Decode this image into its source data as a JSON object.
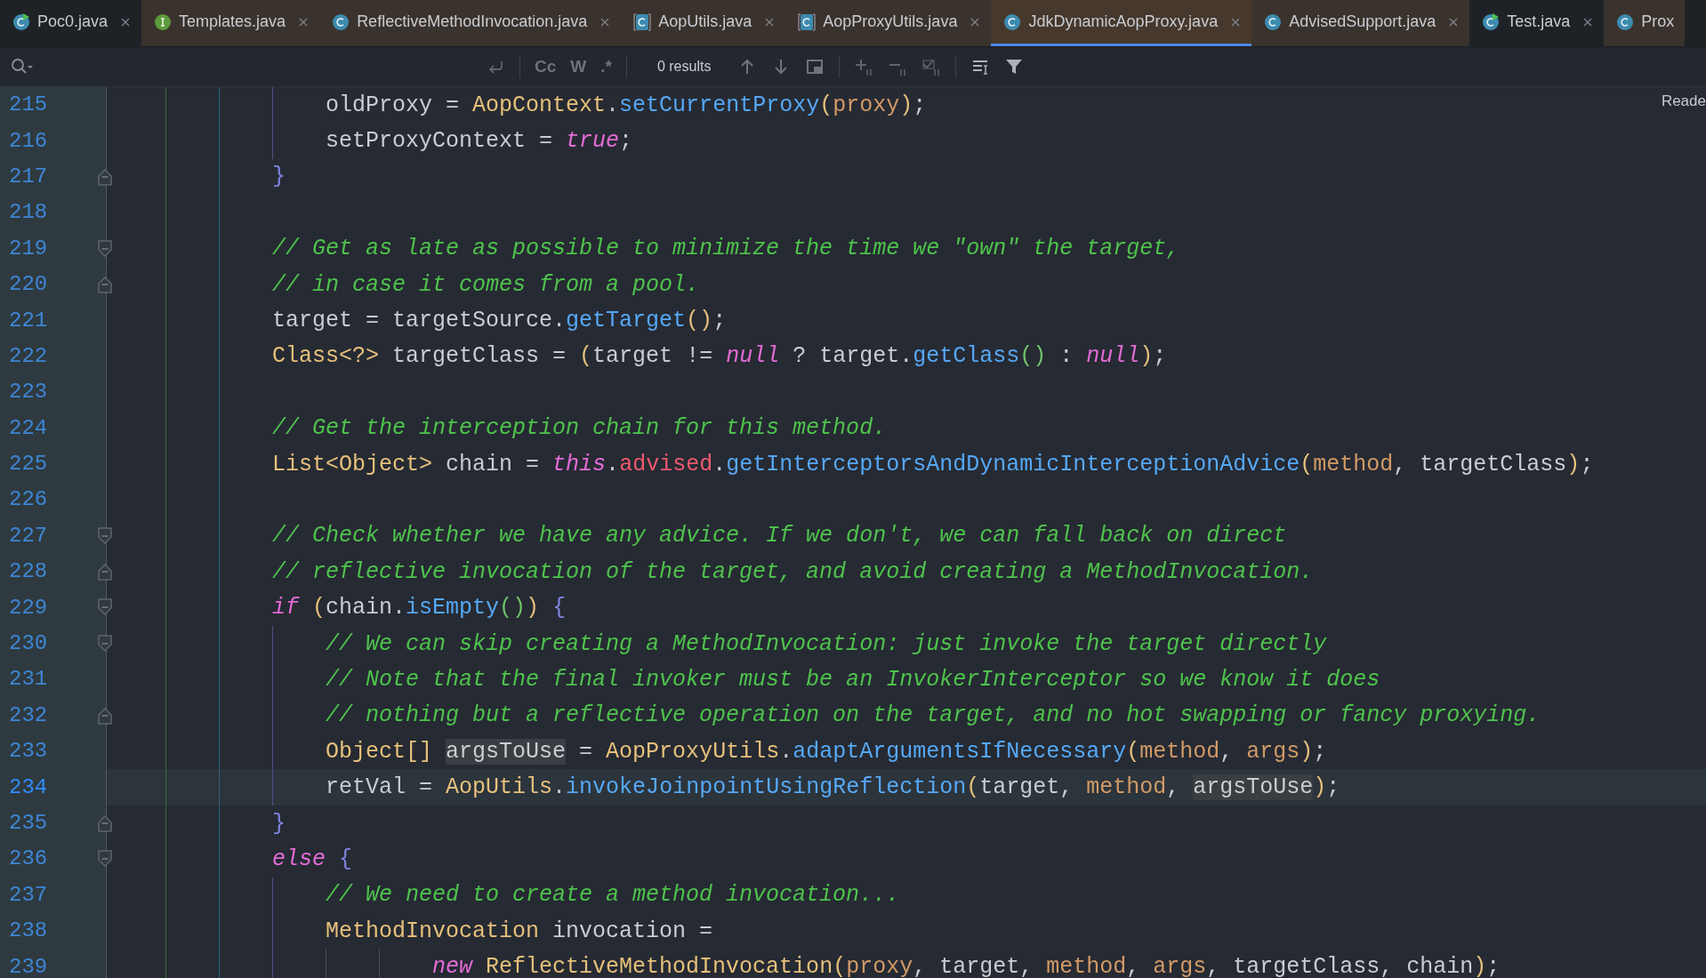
{
  "tabs": [
    {
      "label": "Poc0.java",
      "kind": "runnable",
      "library": false,
      "selected": false,
      "closable": true
    },
    {
      "label": "Templates.java",
      "kind": "interface",
      "library": true,
      "selected": false,
      "closable": true
    },
    {
      "label": "ReflectiveMethodInvocation.java",
      "kind": "class",
      "library": true,
      "selected": false,
      "closable": true
    },
    {
      "label": "AopUtils.java",
      "kind": "readonly",
      "library": true,
      "selected": false,
      "closable": true
    },
    {
      "label": "AopProxyUtils.java",
      "kind": "readonly",
      "library": true,
      "selected": false,
      "closable": true
    },
    {
      "label": "JdkDynamicAopProxy.java",
      "kind": "class",
      "library": true,
      "selected": true,
      "closable": true
    },
    {
      "label": "AdvisedSupport.java",
      "kind": "class",
      "library": true,
      "selected": false,
      "closable": true
    },
    {
      "label": "Test.java",
      "kind": "runnable",
      "library": false,
      "selected": false,
      "closable": true
    },
    {
      "label": "Prox",
      "kind": "class",
      "library": true,
      "selected": false,
      "closable": false
    }
  ],
  "find_bar": {
    "options": [
      {
        "label": "Cc"
      },
      {
        "label": "W"
      },
      {
        "label": ".*"
      }
    ],
    "results": "0 results"
  },
  "reader_mode": "Reade",
  "lines": [
    {
      "number": "215",
      "fold_start": false,
      "fold_end": false,
      "current": false,
      "tokens": [
        {
          "kind": "plain",
          "text": "            oldProxy = "
        },
        {
          "kind": "class",
          "text": "AopContext"
        },
        {
          "kind": "plain",
          "text": "."
        },
        {
          "kind": "method",
          "text": "setCurrentProxy"
        },
        {
          "kind": "paren",
          "text": "("
        },
        {
          "kind": "param",
          "text": "proxy"
        },
        {
          "kind": "paren",
          "text": ")"
        },
        {
          "kind": "plain",
          "text": ";"
        }
      ]
    },
    {
      "number": "216",
      "fold_start": false,
      "fold_end": false,
      "current": false,
      "tokens": [
        {
          "kind": "plain",
          "text": "            setProxyContext = "
        },
        {
          "kind": "keyword",
          "text": "true"
        },
        {
          "kind": "plain",
          "text": ";"
        }
      ]
    },
    {
      "number": "217",
      "fold_start": false,
      "fold_end": true,
      "current": false,
      "tokens": [
        {
          "kind": "brace",
          "text": "        }"
        }
      ]
    },
    {
      "number": "218",
      "fold_start": false,
      "fold_end": false,
      "current": false
    },
    {
      "number": "219",
      "fold_start": true,
      "fold_end": false,
      "current": false,
      "tokens": [
        {
          "kind": "comment",
          "text": "        // Get as late as possible to minimize the time we \"own\" the target,"
        }
      ]
    },
    {
      "number": "220",
      "fold_start": false,
      "fold_end": true,
      "current": false,
      "tokens": [
        {
          "kind": "comment",
          "text": "        // in case it comes from a pool."
        }
      ]
    },
    {
      "number": "221",
      "fold_start": false,
      "fold_end": false,
      "current": false,
      "tokens": [
        {
          "kind": "plain",
          "text": "        target = targetSource."
        },
        {
          "kind": "method",
          "text": "getTarget"
        },
        {
          "kind": "paren",
          "text": "()"
        },
        {
          "kind": "plain",
          "text": ";"
        }
      ]
    },
    {
      "number": "222",
      "fold_start": false,
      "fold_end": false,
      "current": false,
      "tokens": [
        {
          "kind": "class",
          "text": "        Class<?>"
        },
        {
          "kind": "plain",
          "text": " targetClass = "
        },
        {
          "kind": "paren",
          "text": "("
        },
        {
          "kind": "plain",
          "text": "target != "
        },
        {
          "kind": "keyword",
          "text": "null"
        },
        {
          "kind": "plain",
          "text": " ? target."
        },
        {
          "kind": "method",
          "text": "getClass"
        },
        {
          "kind": "paren2",
          "text": "()"
        },
        {
          "kind": "plain",
          "text": " : "
        },
        {
          "kind": "keyword",
          "text": "null"
        },
        {
          "kind": "paren",
          "text": ")"
        },
        {
          "kind": "plain",
          "text": ";"
        }
      ]
    },
    {
      "number": "223",
      "fold_start": false,
      "fold_end": false,
      "current": false
    },
    {
      "number": "224",
      "fold_start": false,
      "fold_end": false,
      "current": false,
      "tokens": [
        {
          "kind": "comment",
          "text": "        // Get the interception chain for this method."
        }
      ]
    },
    {
      "number": "225",
      "fold_start": false,
      "fold_end": false,
      "current": false,
      "tokens": [
        {
          "kind": "class",
          "text": "        List<Object>"
        },
        {
          "kind": "plain",
          "text": " chain = "
        },
        {
          "kind": "keyword",
          "text": "this"
        },
        {
          "kind": "plain",
          "text": "."
        },
        {
          "kind": "field",
          "text": "advised"
        },
        {
          "kind": "plain",
          "text": "."
        },
        {
          "kind": "method",
          "text": "getInterceptorsAndDynamicInterceptionAdvice"
        },
        {
          "kind": "paren",
          "text": "("
        },
        {
          "kind": "param",
          "text": "method"
        },
        {
          "kind": "plain",
          "text": ", targetClass"
        },
        {
          "kind": "paren",
          "text": ")"
        },
        {
          "kind": "plain",
          "text": ";"
        }
      ]
    },
    {
      "number": "226",
      "fold_start": false,
      "fold_end": false,
      "current": false
    },
    {
      "number": "227",
      "fold_start": true,
      "fold_end": false,
      "current": false,
      "tokens": [
        {
          "kind": "comment",
          "text": "        // Check whether we have any advice. If we don't, we can fall back on direct"
        }
      ]
    },
    {
      "number": "228",
      "fold_start": false,
      "fold_end": true,
      "current": false,
      "tokens": [
        {
          "kind": "comment",
          "text": "        // reflective invocation of the target, and avoid creating a MethodInvocation."
        }
      ]
    },
    {
      "number": "229",
      "fold_start": true,
      "fold_end": false,
      "current": false,
      "tokens": [
        {
          "kind": "keyword",
          "text": "        if"
        },
        {
          "kind": "paren",
          "text": " ("
        },
        {
          "kind": "plain",
          "text": "chain."
        },
        {
          "kind": "method",
          "text": "isEmpty"
        },
        {
          "kind": "paren2",
          "text": "()"
        },
        {
          "kind": "paren",
          "text": ")"
        },
        {
          "kind": "brace",
          "text": " {"
        }
      ]
    },
    {
      "number": "230",
      "fold_start": true,
      "fold_end": false,
      "current": false,
      "tokens": [
        {
          "kind": "comment",
          "text": "            // We can skip creating a MethodInvocation: just invoke the target directly"
        }
      ]
    },
    {
      "number": "231",
      "fold_start": false,
      "fold_end": false,
      "current": false,
      "tokens": [
        {
          "kind": "comment",
          "text": "            // Note that the final invoker must be an InvokerInterceptor so we know it does"
        }
      ]
    },
    {
      "number": "232",
      "fold_start": false,
      "fold_end": true,
      "current": false,
      "tokens": [
        {
          "kind": "comment",
          "text": "            // nothing but a reflective operation on the target, and no hot swapping or fancy proxying."
        }
      ]
    },
    {
      "number": "233",
      "fold_start": false,
      "fold_end": false,
      "current": false,
      "tokens": [
        {
          "kind": "class",
          "text": "            Object"
        },
        {
          "kind": "paren",
          "text": "[] "
        },
        {
          "kind": "usage",
          "text": "argsToUse"
        },
        {
          "kind": "plain",
          "text": " = "
        },
        {
          "kind": "class",
          "text": "AopProxyUtils"
        },
        {
          "kind": "plain",
          "text": "."
        },
        {
          "kind": "method",
          "text": "adaptArgumentsIfNecessary"
        },
        {
          "kind": "paren",
          "text": "("
        },
        {
          "kind": "param",
          "text": "method"
        },
        {
          "kind": "plain",
          "text": ", "
        },
        {
          "kind": "param",
          "text": "args"
        },
        {
          "kind": "paren",
          "text": ")"
        },
        {
          "kind": "plain",
          "text": ";"
        }
      ]
    },
    {
      "number": "234",
      "fold_start": false,
      "fold_end": false,
      "current": true,
      "tokens": [
        {
          "kind": "plain",
          "text": "            retVal = "
        },
        {
          "kind": "class",
          "text": "AopUtils"
        },
        {
          "kind": "plain",
          "text": "."
        },
        {
          "kind": "method",
          "text": "invokeJoinpointUsingReflection"
        },
        {
          "kind": "paren",
          "text": "("
        },
        {
          "kind": "plain",
          "text": "target, "
        },
        {
          "kind": "param",
          "text": "method"
        },
        {
          "kind": "plain",
          "text": ", "
        },
        {
          "kind": "usage",
          "text": "argsToUse"
        },
        {
          "kind": "paren",
          "text": ")"
        },
        {
          "kind": "plain",
          "text": ";"
        }
      ]
    },
    {
      "number": "235",
      "fold_start": false,
      "fold_end": true,
      "current": false,
      "tokens": [
        {
          "kind": "brace",
          "text": "        }"
        }
      ]
    },
    {
      "number": "236",
      "fold_start": true,
      "fold_end": false,
      "current": false,
      "tokens": [
        {
          "kind": "keyword",
          "text": "        else"
        },
        {
          "kind": "brace",
          "text": " {"
        }
      ]
    },
    {
      "number": "237",
      "fold_start": false,
      "fold_end": false,
      "current": false,
      "tokens": [
        {
          "kind": "comment",
          "text": "            // We need to create a method invocation..."
        }
      ]
    },
    {
      "number": "238",
      "fold_start": false,
      "fold_end": false,
      "current": false,
      "tokens": [
        {
          "kind": "class",
          "text": "            MethodInvocation"
        },
        {
          "kind": "plain",
          "text": " invocation ="
        }
      ]
    },
    {
      "number": "239",
      "fold_start": false,
      "fold_end": false,
      "current": false,
      "tokens": [
        {
          "kind": "keyword",
          "text": "                    new"
        },
        {
          "kind": "class",
          "text": " ReflectiveMethodInvocation"
        },
        {
          "kind": "paren",
          "text": "("
        },
        {
          "kind": "param",
          "text": "proxy"
        },
        {
          "kind": "plain",
          "text": ", target, "
        },
        {
          "kind": "param",
          "text": "method"
        },
        {
          "kind": "plain",
          "text": ", "
        },
        {
          "kind": "param",
          "text": "args"
        },
        {
          "kind": "plain",
          "text": ", targetClass, chain"
        },
        {
          "kind": "paren",
          "text": ")"
        },
        {
          "kind": "plain",
          "text": ";"
        }
      ]
    }
  ]
}
